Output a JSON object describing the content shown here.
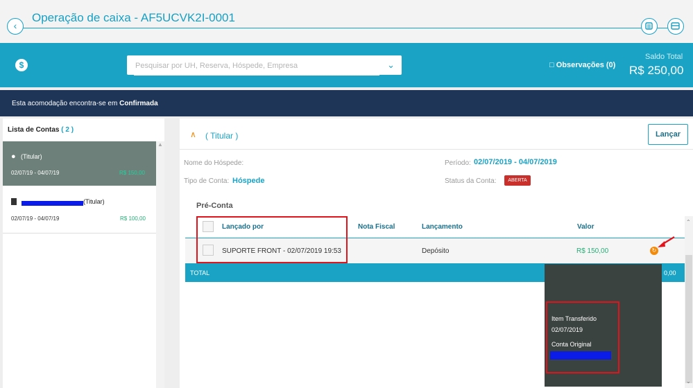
{
  "header": {
    "title": "Operação de caixa - AF5UCVK2I-0001",
    "back_icon": "arrow-left-icon",
    "icons": [
      "list-icon",
      "card-icon"
    ]
  },
  "search": {
    "placeholder": "Pesquisar por UH, Reserva, Hóspede, Empresa"
  },
  "toolbar": {
    "observations_label": "Observações (0)",
    "balance_label": "Saldo Total",
    "balance_value": "R$ 250,00"
  },
  "status_strip": {
    "text_prefix": "Esta acomodação encontra-se em ",
    "status": "Confirmada"
  },
  "accounts": {
    "title": "Lista de Contas",
    "count": "( 2 )",
    "items": [
      {
        "label": "(Titular)",
        "dates": "02/07/19 - 04/07/19",
        "amount": "R$ 150,00"
      },
      {
        "label": "(Titular)",
        "dates": "02/07/19 - 04/07/19",
        "amount": "R$ 100,00"
      }
    ]
  },
  "detail": {
    "heading": "( Titular )",
    "launch_button": "Lançar",
    "guest_name_label": "Nome do Hóspede:",
    "account_type_label": "Tipo de Conta:",
    "account_type_value": "Hóspede",
    "period_label": "Período:",
    "period_value": "02/07/2019 - 04/07/2019",
    "account_status_label": "Status da Conta:",
    "account_status_value": "ABERTA"
  },
  "table": {
    "section_title": "Pré-Conta",
    "columns": [
      "Lançado por",
      "Nota Fiscal",
      "Lançamento",
      "Valor"
    ],
    "rows": [
      {
        "launched_by": "SUPORTE FRONT - 02/07/2019 19:53",
        "invoice": "",
        "entry": "Depósito",
        "value": "R$ 150,00"
      }
    ],
    "total_label": "TOTAL",
    "total_value_visible": "0,00"
  },
  "tooltip": {
    "line1": "Item Transferido",
    "line2": "02/07/2019",
    "line3": "Conta Original"
  },
  "colors": {
    "accent": "#1aa3c5",
    "dark_strip": "#1e3557",
    "selected_card": "#6d8079",
    "badge_red": "#c9302c",
    "annotation_red": "#e3131b"
  }
}
